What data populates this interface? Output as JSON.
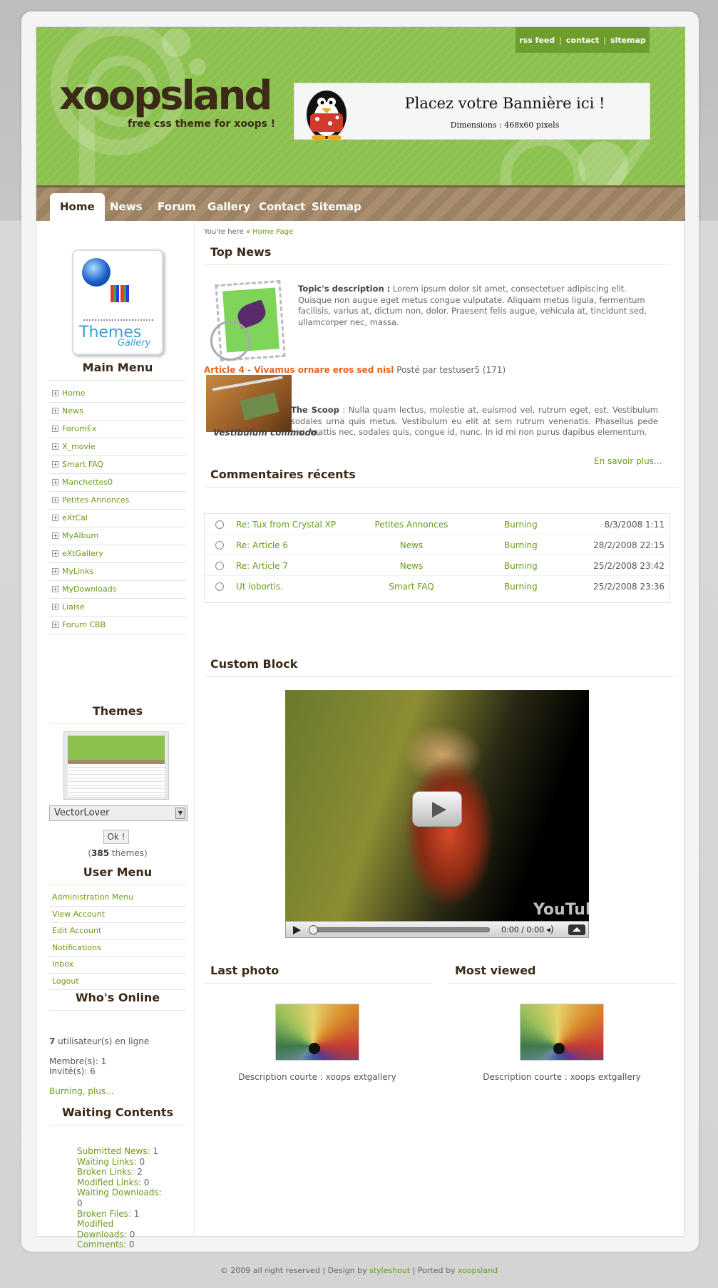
{
  "header": {
    "logo": "xoopsland",
    "slogan": "free css theme for xoops !",
    "toplinks": [
      "rss feed",
      "contact",
      "sitemap"
    ],
    "separator": "|",
    "banner_title": "Placez votre Bannière ici !",
    "banner_sub": "Dimensions : 468x60 pixels"
  },
  "nav": {
    "items": [
      "Home",
      "News",
      "Forum",
      "Gallery",
      "Contact",
      "Sitemap"
    ],
    "active": "Home"
  },
  "sidebar": {
    "gallery_logo": {
      "text1": "Themes",
      "text2": "Gallery"
    },
    "main_menu": {
      "title": "Main Menu",
      "plus_glyph": "+",
      "items": [
        "Home",
        "News",
        "ForumEx",
        "X_movie",
        "Smart FAQ",
        "Manchettes0",
        "Petites Annonces",
        "eXtCal",
        "MyAlbum",
        "eXtGallery",
        "MyLinks",
        "MyDownloads",
        "Liaise",
        "Forum CBB"
      ]
    },
    "themes": {
      "title": "Themes",
      "selected": "VectorLover",
      "ok_label": "Ok !",
      "count_prefix": "(",
      "count": "385",
      "count_suffix": " themes)"
    },
    "user_menu": {
      "title": "User Menu",
      "items": [
        "Administration Menu",
        "View Account",
        "Edit Account",
        "Notifications",
        "Inbox",
        "Logout"
      ]
    },
    "whos_online": {
      "title": "Who's Online",
      "count": "7",
      "count_label": " utilisateur(s) en ligne",
      "members": "Membre(s): 1",
      "guests": "Invité(s): 6",
      "link": "Burning, plus..."
    },
    "waiting": {
      "title": "Waiting Contents",
      "items": [
        {
          "label": "Submitted News:",
          "value": " 1"
        },
        {
          "label": "Waiting Links:",
          "value": " 0"
        },
        {
          "label": "Broken Links:",
          "value": " 2"
        },
        {
          "label": "Modified Links:",
          "value": " 0"
        },
        {
          "label": "Waiting Downloads:",
          "value": "0"
        },
        {
          "label": "Broken Files:",
          "value": " 1"
        },
        {
          "label": "Modified Downloads:",
          "value": " 0"
        },
        {
          "label": "Comments:",
          "value": " 0"
        }
      ]
    }
  },
  "main": {
    "breadcrumb": {
      "prefix": "You're here » ",
      "current": "Home Page"
    },
    "top_news": {
      "title": "Top News",
      "topic_label": "Topic's description :",
      "topic_text": " Lorem ipsum dolor sit amet, consectetuer adipiscing elit. Quisque non augue eget metus congue vulputate. Aliquam metus ligula, fermentum facilisis, varius at, dictum non, dolor. Praesent felis augue, vehicula at, tincidunt sed, ullamcorper nec, massa.",
      "article_title": "Article 4 - Vivamus ornare eros sed nisl",
      "article_meta": " Posté par testuser5 (171)",
      "scoop_label": "The Scoop",
      "scoop_text": " : Nulla quam lectus, molestie at, euismod vel, rutrum eget, est. Vestibulum sodales urna quis metus. Vestibulum eu elit at sem rutrum venenatis. Phasellus pede nisi, mattis nec, sodales quis, congue id, nunc. In id mi non purus dapibus elementum.",
      "scoop_tail": "Vestibulum commodo",
      "scoop_tail_end": ".",
      "more": "En savoir plus..."
    },
    "comments": {
      "title": "Commentaires récents",
      "rows": [
        {
          "title": "Re: Tux from Crystal XP",
          "module": "Petites Annonces",
          "user": "Burning",
          "date": "8/3/2008 1:11"
        },
        {
          "title": "Re: Article 6",
          "module": "News",
          "user": "Burning",
          "date": "28/2/2008 22:15"
        },
        {
          "title": "Re: Article 7",
          "module": "News",
          "user": "Burning",
          "date": "25/2/2008 23:42"
        },
        {
          "title": "Ut lobortis.",
          "module": "Smart FAQ",
          "user": "Burning",
          "date": "25/2/2008 23:36"
        }
      ]
    },
    "custom_block": {
      "title": "Custom Block",
      "video_time": "0:00 / 0:00",
      "video_logo": "YouTube",
      "volume_glyph": "◂)"
    },
    "last_photo": {
      "title": "Last photo",
      "caption": "Description courte : xoops extgallery"
    },
    "most_viewed": {
      "title": "Most viewed",
      "caption": "Description courte : xoops extgallery"
    }
  },
  "footer": {
    "text1": "© 2009 all right reserved | Design by ",
    "link1": "styleshout",
    "text2": " | Ported by ",
    "link2": "xoopsland"
  },
  "colors": {
    "header_green": "#8dc14f",
    "nav_brown": "#a58a69",
    "link_green": "#6b9a1a",
    "article_orange": "#e5641a",
    "title_brown": "#3a2a17"
  }
}
